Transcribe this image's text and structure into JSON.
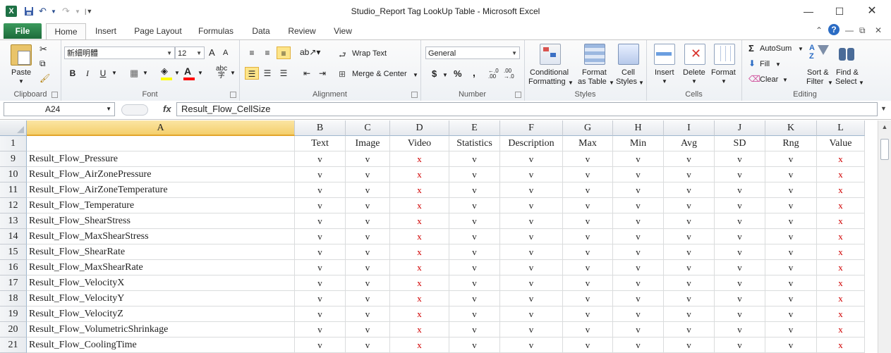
{
  "window": {
    "title": "Studio_Report Tag LookUp Table  -  Microsoft Excel",
    "app_icon": "X",
    "controls": [
      "minimize-icon",
      "maximize-icon",
      "close-icon"
    ]
  },
  "tabs": {
    "file": "File",
    "items": [
      "Home",
      "Insert",
      "Page Layout",
      "Formulas",
      "Data",
      "Review",
      "View"
    ],
    "active": "Home"
  },
  "ribbon": {
    "clipboard": {
      "label": "Clipboard",
      "paste": "Paste"
    },
    "font": {
      "label": "Font",
      "name": "新細明體",
      "size": "12",
      "grow": "A",
      "shrink": "A",
      "bold": "B",
      "italic": "I",
      "underline": "U",
      "fill_color": "#ffff00",
      "font_color": "#ff0000",
      "font_color_letter": "A"
    },
    "alignment": {
      "label": "Alignment",
      "wrap_text": "Wrap Text",
      "merge_center": "Merge & Center"
    },
    "number": {
      "label": "Number",
      "format": "General",
      "currency": "$",
      "percent": "%",
      "comma": ",",
      "inc_decimal": "+.0 .00",
      "dec_decimal": ".00 →.0"
    },
    "styles": {
      "label": "Styles",
      "conditional": "Conditional",
      "conditional2": "Formatting",
      "format_table": "Format",
      "format_table2": "as Table",
      "cell_styles": "Cell",
      "cell_styles2": "Styles"
    },
    "cells": {
      "label": "Cells",
      "insert": "Insert",
      "delete": "Delete",
      "format": "Format"
    },
    "editing": {
      "label": "Editing",
      "autosum": "AutoSum",
      "fill": "Fill",
      "clear": "Clear",
      "sort": "Sort &",
      "sort2": "Filter",
      "find": "Find &",
      "find2": "Select"
    }
  },
  "formula_bar": {
    "name_box": "A24",
    "fx": "fx",
    "content": "Result_Flow_CellSize"
  },
  "sheet": {
    "columns": [
      "A",
      "B",
      "C",
      "D",
      "E",
      "F",
      "G",
      "H",
      "I",
      "J",
      "K",
      "L"
    ],
    "selected_column": "A",
    "header_row": {
      "row": "1",
      "values": [
        "",
        "Text",
        "Image",
        "Video",
        "Statistics",
        "Description",
        "Max",
        "Min",
        "Avg",
        "SD",
        "Rng",
        "Value"
      ]
    },
    "rows": [
      {
        "row": "9",
        "name": "Result_Flow_Pressure",
        "marks": [
          "v",
          "v",
          "x",
          "v",
          "v",
          "v",
          "v",
          "v",
          "v",
          "v",
          "x"
        ]
      },
      {
        "row": "10",
        "name": "Result_Flow_AirZonePressure",
        "marks": [
          "v",
          "v",
          "x",
          "v",
          "v",
          "v",
          "v",
          "v",
          "v",
          "v",
          "x"
        ]
      },
      {
        "row": "11",
        "name": "Result_Flow_AirZoneTemperature",
        "marks": [
          "v",
          "v",
          "x",
          "v",
          "v",
          "v",
          "v",
          "v",
          "v",
          "v",
          "x"
        ]
      },
      {
        "row": "12",
        "name": "Result_Flow_Temperature",
        "marks": [
          "v",
          "v",
          "x",
          "v",
          "v",
          "v",
          "v",
          "v",
          "v",
          "v",
          "x"
        ]
      },
      {
        "row": "13",
        "name": "Result_Flow_ShearStress",
        "marks": [
          "v",
          "v",
          "x",
          "v",
          "v",
          "v",
          "v",
          "v",
          "v",
          "v",
          "x"
        ]
      },
      {
        "row": "14",
        "name": "Result_Flow_MaxShearStress",
        "marks": [
          "v",
          "v",
          "x",
          "v",
          "v",
          "v",
          "v",
          "v",
          "v",
          "v",
          "x"
        ]
      },
      {
        "row": "15",
        "name": "Result_Flow_ShearRate",
        "marks": [
          "v",
          "v",
          "x",
          "v",
          "v",
          "v",
          "v",
          "v",
          "v",
          "v",
          "x"
        ]
      },
      {
        "row": "16",
        "name": "Result_Flow_MaxShearRate",
        "marks": [
          "v",
          "v",
          "x",
          "v",
          "v",
          "v",
          "v",
          "v",
          "v",
          "v",
          "x"
        ]
      },
      {
        "row": "17",
        "name": "Result_Flow_VelocityX",
        "marks": [
          "v",
          "v",
          "x",
          "v",
          "v",
          "v",
          "v",
          "v",
          "v",
          "v",
          "x"
        ]
      },
      {
        "row": "18",
        "name": "Result_Flow_VelocityY",
        "marks": [
          "v",
          "v",
          "x",
          "v",
          "v",
          "v",
          "v",
          "v",
          "v",
          "v",
          "x"
        ]
      },
      {
        "row": "19",
        "name": "Result_Flow_VelocityZ",
        "marks": [
          "v",
          "v",
          "x",
          "v",
          "v",
          "v",
          "v",
          "v",
          "v",
          "v",
          "x"
        ]
      },
      {
        "row": "20",
        "name": "Result_Flow_VolumetricShrinkage",
        "marks": [
          "v",
          "v",
          "x",
          "v",
          "v",
          "v",
          "v",
          "v",
          "v",
          "v",
          "x"
        ]
      },
      {
        "row": "21",
        "name": "Result_Flow_CoolingTime",
        "marks": [
          "v",
          "v",
          "x",
          "v",
          "v",
          "v",
          "v",
          "v",
          "v",
          "v",
          "x"
        ]
      }
    ]
  },
  "colors": {
    "x_mark": "#d00000",
    "file_tab": "#217346",
    "selected_header": "#f4cf6c"
  }
}
